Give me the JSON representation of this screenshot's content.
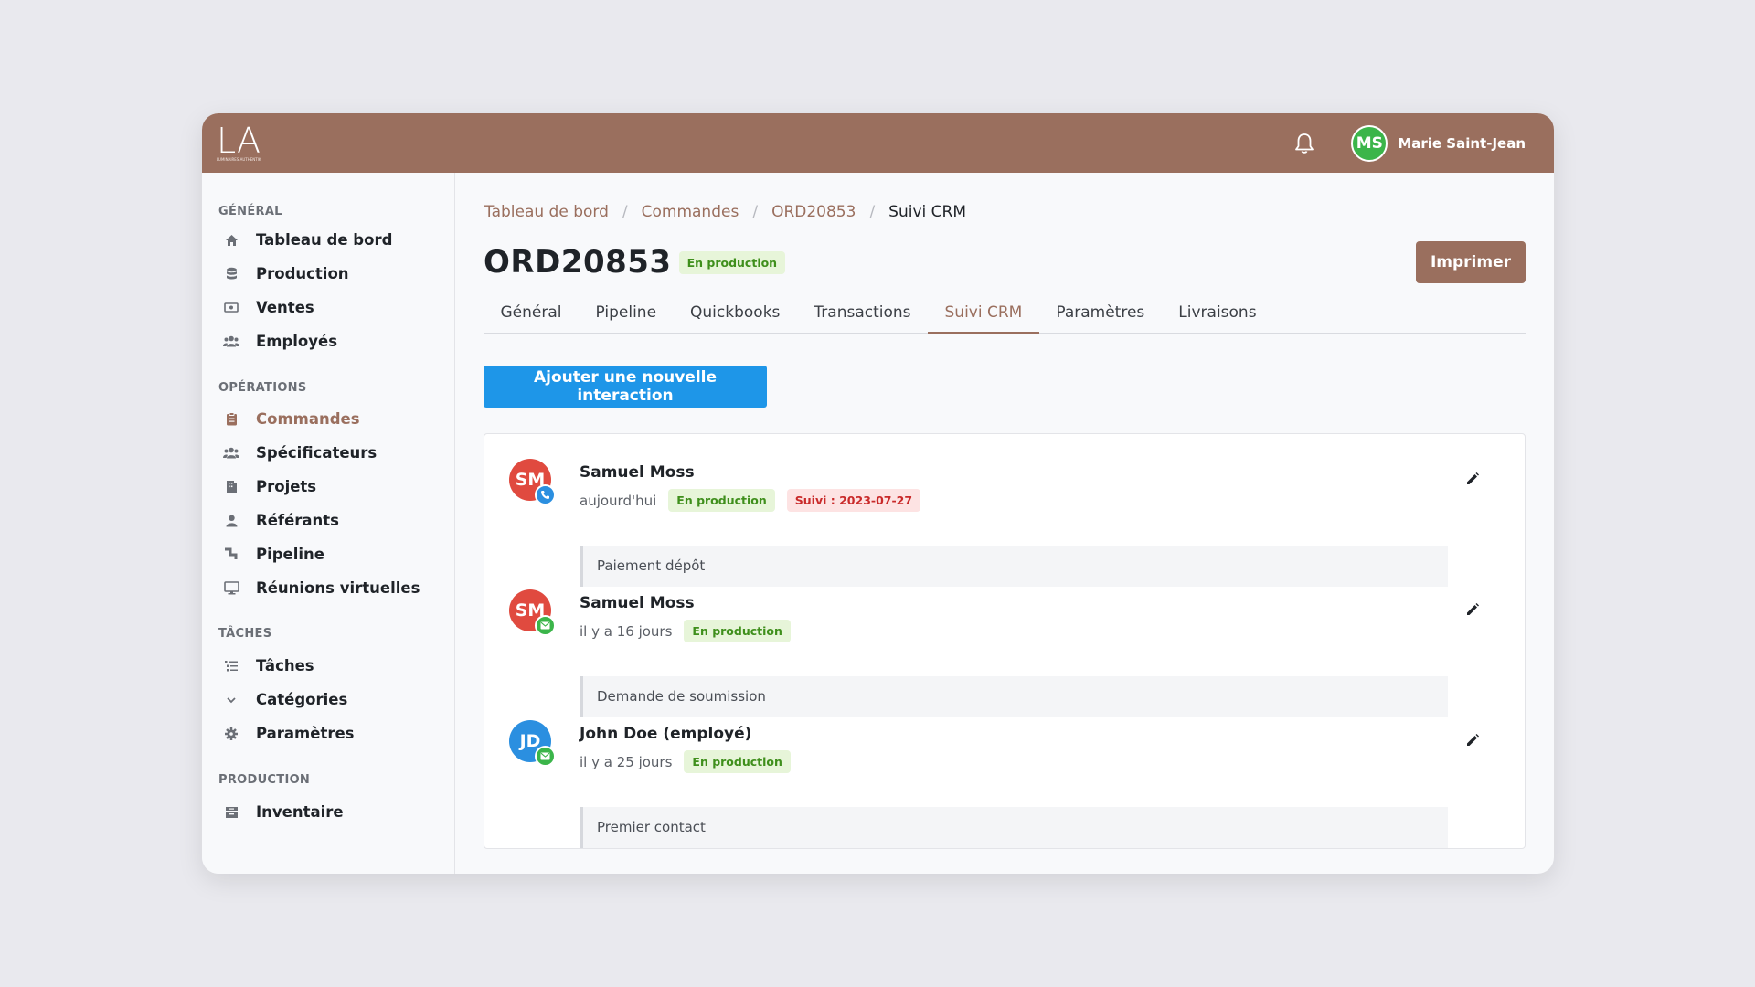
{
  "app": {
    "logo_text": "LA",
    "logo_subtext": "LUMINAIRES AUTHENTIK",
    "user": {
      "initials": "MS",
      "name": "Marie Saint-Jean"
    }
  },
  "colors": {
    "brand": "#9a6f5e",
    "primary": "#1e96e8",
    "success": "#3bb54a",
    "danger": "#e04a3f",
    "info": "#2b8fe0"
  },
  "sidebar": {
    "sections": [
      {
        "title": "GÉNÉRAL",
        "items": [
          {
            "label": "Tableau de bord",
            "icon": "home-icon"
          },
          {
            "label": "Production",
            "icon": "database-icon"
          },
          {
            "label": "Ventes",
            "icon": "money-icon"
          },
          {
            "label": "Employés",
            "icon": "users-icon"
          }
        ]
      },
      {
        "title": "OPÉRATIONS",
        "items": [
          {
            "label": "Commandes",
            "icon": "clipboard-icon",
            "active": true
          },
          {
            "label": "Spécificateurs",
            "icon": "users-icon"
          },
          {
            "label": "Projets",
            "icon": "building-icon"
          },
          {
            "label": "Référants",
            "icon": "user-icon"
          },
          {
            "label": "Pipeline",
            "icon": "pipeline-icon"
          },
          {
            "label": "Réunions virtuelles",
            "icon": "monitor-icon"
          }
        ]
      },
      {
        "title": "TÂCHES",
        "items": [
          {
            "label": "Tâches",
            "icon": "tasks-icon"
          },
          {
            "label": "Catégories",
            "icon": "chevron-down-icon"
          },
          {
            "label": "Paramètres",
            "icon": "gear-icon"
          }
        ]
      },
      {
        "title": "PRODUCTION",
        "items": [
          {
            "label": "Inventaire",
            "icon": "inventory-icon"
          }
        ]
      }
    ]
  },
  "breadcrumb": [
    "Tableau de bord",
    "Commandes",
    "ORD20853",
    "Suivi CRM"
  ],
  "page": {
    "title": "ORD20853",
    "status": "En production",
    "print_label": "Imprimer"
  },
  "tabs": [
    {
      "label": "Général"
    },
    {
      "label": "Pipeline"
    },
    {
      "label": "Quickbooks"
    },
    {
      "label": "Transactions"
    },
    {
      "label": "Suivi CRM",
      "active": true
    },
    {
      "label": "Paramètres"
    },
    {
      "label": "Livraisons"
    }
  ],
  "add_interaction_label": "Ajouter une nouvelle interaction",
  "interactions": [
    {
      "initials": "SM",
      "name": "Samuel Moss",
      "time": "aujourd'hui",
      "status": "En production",
      "followup": "Suivi : 2023-07-27",
      "note": "Paiement dépôt",
      "channel": "phone-icon"
    },
    {
      "initials": "SM",
      "name": "Samuel Moss",
      "time": "il y a 16 jours",
      "status": "En production",
      "note": "Demande de soumission",
      "channel": "email-icon"
    },
    {
      "initials": "JD",
      "name": "John Doe (employé)",
      "time": "il y a 25 jours",
      "status": "En production",
      "note": "Premier contact",
      "channel": "email-icon"
    }
  ]
}
